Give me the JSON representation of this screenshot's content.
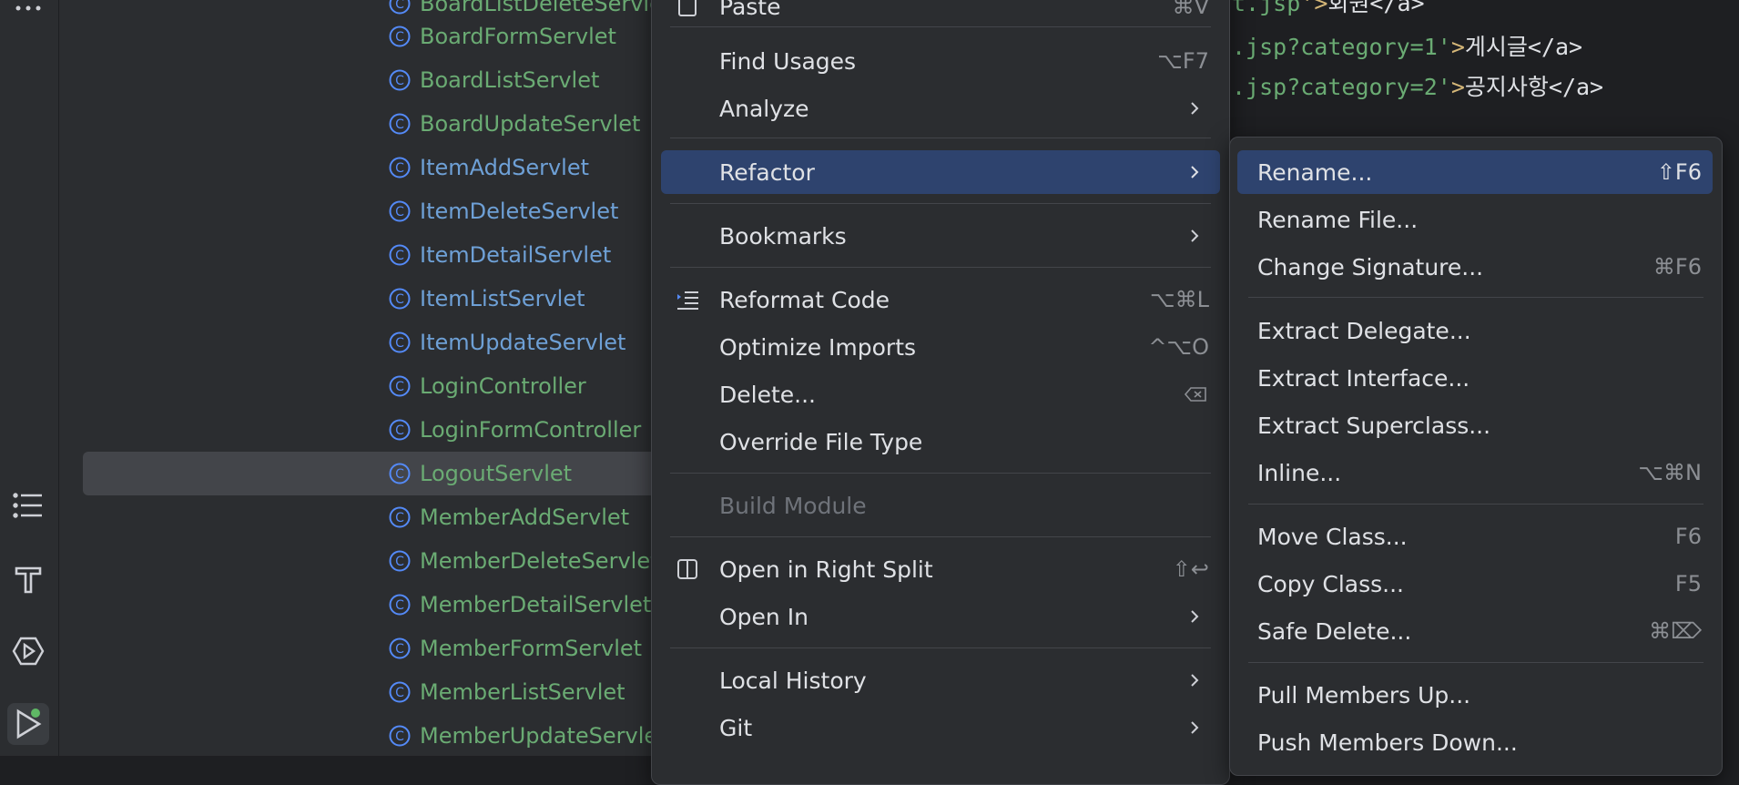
{
  "tree": {
    "items": [
      {
        "label": "BoardFormServlet",
        "color": "green"
      },
      {
        "label": "BoardListServlet",
        "color": "green"
      },
      {
        "label": "BoardUpdateServlet",
        "color": "green"
      },
      {
        "label": "ItemAddServlet",
        "color": "blue"
      },
      {
        "label": "ItemDeleteServlet",
        "color": "blue"
      },
      {
        "label": "ItemDetailServlet",
        "color": "blue"
      },
      {
        "label": "ItemListServlet",
        "color": "blue"
      },
      {
        "label": "ItemUpdateServlet",
        "color": "blue"
      },
      {
        "label": "LoginController",
        "color": "green"
      },
      {
        "label": "LoginFormController",
        "color": "green"
      },
      {
        "label": "LogoutServlet",
        "color": "green",
        "selected": true
      },
      {
        "label": "MemberAddServlet",
        "color": "green"
      },
      {
        "label": "MemberDeleteServlet",
        "color": "green"
      },
      {
        "label": "MemberDetailServlet",
        "color": "green"
      },
      {
        "label": "MemberFormServlet",
        "color": "green"
      },
      {
        "label": "MemberListServlet",
        "color": "green"
      },
      {
        "label": "MemberUpdateServlet",
        "color": "green"
      }
    ]
  },
  "editor": {
    "line1": {
      "str": "t.jsp",
      "tag": "'>",
      "txt": "회원</a>"
    },
    "line2": {
      "str": ".jsp?category=1'",
      "tag": ">",
      "txt": "게시글</a>"
    },
    "line3": {
      "str": ".jsp?category=2'",
      "tag": ">",
      "txt": "공지사항</a>"
    }
  },
  "menu": {
    "paste": {
      "label": "Paste",
      "shortcut": "⌘V"
    },
    "find_usages": {
      "label": "Find Usages",
      "shortcut": "⌥F7"
    },
    "analyze": {
      "label": "Analyze"
    },
    "refactor": {
      "label": "Refactor"
    },
    "bookmarks": {
      "label": "Bookmarks"
    },
    "reformat": {
      "label": "Reformat Code",
      "shortcut": "⌥⌘L"
    },
    "optimize": {
      "label": "Optimize Imports",
      "shortcut": "^⌥O"
    },
    "delete": {
      "label": "Delete..."
    },
    "override": {
      "label": "Override File Type"
    },
    "build": {
      "label": "Build Module"
    },
    "open_right": {
      "label": "Open in Right Split",
      "shortcut": "⇧↩"
    },
    "open_in": {
      "label": "Open In"
    },
    "local_history": {
      "label": "Local History"
    },
    "git": {
      "label": "Git"
    }
  },
  "submenu": {
    "rename": {
      "label": "Rename...",
      "shortcut": "⇧F6"
    },
    "rename_file": {
      "label": "Rename File..."
    },
    "change_sig": {
      "label": "Change Signature...",
      "shortcut": "⌘F6"
    },
    "extract_delegate": {
      "label": "Extract Delegate..."
    },
    "extract_interface": {
      "label": "Extract Interface..."
    },
    "extract_superclass": {
      "label": "Extract Superclass..."
    },
    "inline": {
      "label": "Inline...",
      "shortcut": "⌥⌘N"
    },
    "move_class": {
      "label": "Move Class...",
      "shortcut": "F6"
    },
    "copy_class": {
      "label": "Copy Class...",
      "shortcut": "F5"
    },
    "safe_delete": {
      "label": "Safe Delete...",
      "shortcut": "⌘⌦"
    },
    "pull_up": {
      "label": "Pull Members Up..."
    },
    "push_down": {
      "label": "Push Members Down..."
    }
  }
}
